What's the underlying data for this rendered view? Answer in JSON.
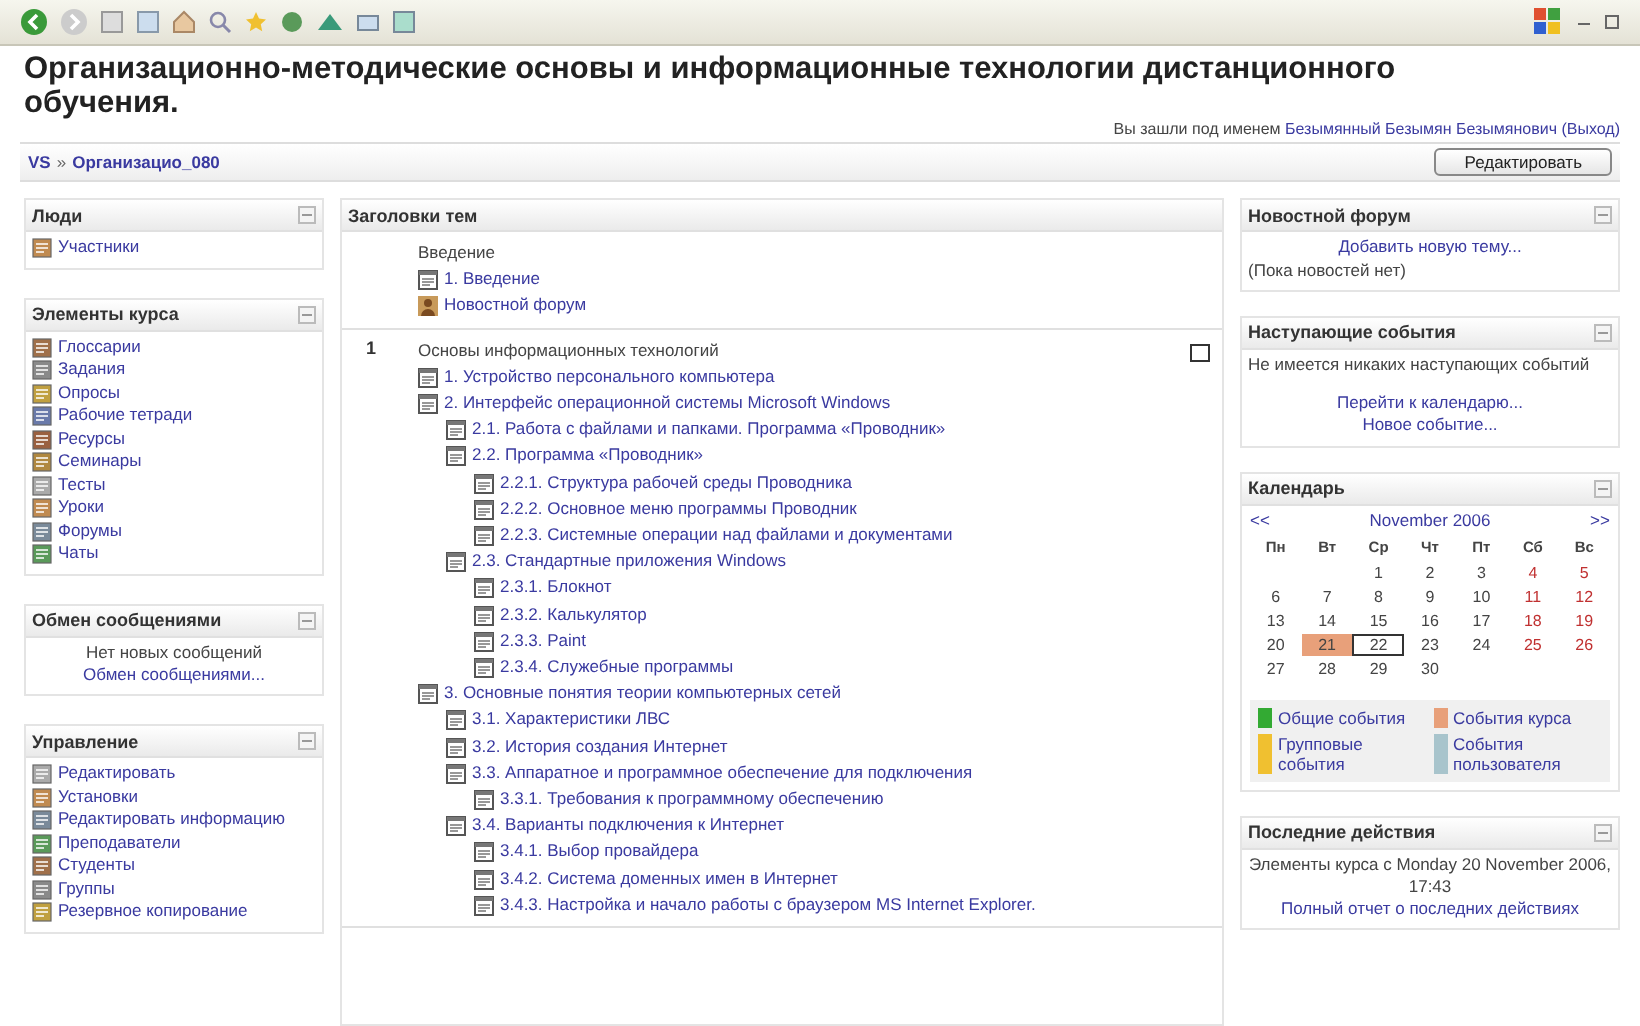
{
  "header": {
    "title": "Организационно-методические основы и информационные технологии дистанционного обучения.",
    "login": {
      "prefix": "Вы зашли под именем",
      "user": "Безымянный Безымян Безымянович",
      "logout": "(Выход)"
    }
  },
  "navbar": {
    "crumbs": [
      "VS",
      "Организацио_080"
    ],
    "separator": "»",
    "button": "Редактировать"
  },
  "left_blocks": [
    {
      "title": "Люди",
      "kind": "links",
      "items": [
        "Участники"
      ]
    },
    {
      "title": "Элементы курса",
      "kind": "links",
      "items": [
        "Глоссарии",
        "Задания",
        "Опросы",
        "Рабочие тетради",
        "Ресурсы",
        "Семинары",
        "Тесты",
        "Уроки",
        "Форумы",
        "Чаты"
      ]
    },
    {
      "title": "Обмен сообщениями",
      "kind": "text",
      "lines": [
        {
          "text": "Нет новых сообщений",
          "link": false
        },
        {
          "text": "Обмен сообщениями...",
          "link": true
        }
      ]
    },
    {
      "title": "Управление",
      "kind": "links",
      "items": [
        "Редактировать",
        "Установки",
        "Редактировать информацию",
        "Преподаватели",
        "Студенты",
        "Группы",
        "Резервное копирование"
      ]
    }
  ],
  "center": {
    "title": "Заголовки тем",
    "sections": [
      {
        "summary": "Введение",
        "items": [
          {
            "label": "1. Введение",
            "kind": "page"
          },
          {
            "label": "Новостной форум",
            "kind": "forum"
          }
        ]
      },
      {
        "number": "1",
        "summary": "Основы информационных технологий",
        "highlight_toggle": true,
        "items": [
          {
            "label": "1. Устройство персонального компьютера",
            "kind": "page"
          },
          {
            "label": "2. Интерфейс операционной системы Microsoft Windows",
            "kind": "page",
            "children": [
              {
                "label": "2.1. Работа с файлами и папками. Программа «Проводник»",
                "kind": "page"
              },
              {
                "label": "2.2. Программа «Проводник»",
                "kind": "page",
                "children": [
                  {
                    "label": "2.2.1. Структура рабочей среды Проводника",
                    "kind": "page"
                  },
                  {
                    "label": "2.2.2. Основное меню программы Проводник",
                    "kind": "page"
                  },
                  {
                    "label": "2.2.3. Системные операции над файлами и документами",
                    "kind": "page"
                  }
                ]
              },
              {
                "label": "2.3. Стандартные приложения Windows",
                "kind": "page",
                "children": [
                  {
                    "label": "2.3.1. Блокнот",
                    "kind": "page"
                  },
                  {
                    "label": "2.3.2. Калькулятор",
                    "kind": "page"
                  },
                  {
                    "label": "2.3.3. Paint",
                    "kind": "page"
                  },
                  {
                    "label": "2.3.4. Служебные программы",
                    "kind": "page"
                  }
                ]
              }
            ]
          },
          {
            "label": "3. Основные понятия теории компьютерных сетей",
            "kind": "page",
            "children": [
              {
                "label": "3.1. Характеристики ЛВС",
                "kind": "page"
              },
              {
                "label": "3.2. История создания Интернет",
                "kind": "page"
              },
              {
                "label": "3.3. Аппаратное и программное обеспечение для подключения",
                "kind": "page",
                "children": [
                  {
                    "label": "3.3.1. Требования к программному обеспечению",
                    "kind": "page"
                  }
                ]
              },
              {
                "label": "3.4. Варианты подключения к Интернет",
                "kind": "page",
                "children": [
                  {
                    "label": "3.4.1. Выбор провайдера",
                    "kind": "page"
                  },
                  {
                    "label": "3.4.2. Система доменных имен в Интернет",
                    "kind": "page"
                  },
                  {
                    "label": "3.4.3. Настройка и начало работы с браузером MS Internet Explorer.",
                    "kind": "page"
                  }
                ]
              }
            ]
          }
        ]
      }
    ]
  },
  "news": {
    "title": "Новостной форум",
    "link": "Добавить новую тему...",
    "note": "(Пока новостей нет)"
  },
  "upcoming": {
    "title": "Наступающие события",
    "note": "Не имеется никаких наступающих событий",
    "links": [
      "Перейти к календарю...",
      "Новое событие..."
    ]
  },
  "calendar": {
    "title": "Календарь",
    "prev": "<<",
    "month": "November 2006",
    "next": ">>",
    "weekdays": [
      "Пн",
      "Вт",
      "Ср",
      "Чт",
      "Пт",
      "Сб",
      "Вс"
    ],
    "weeks": [
      [
        {
          "d": "1",
          "event": false,
          "today": false
        },
        {
          "d": "2",
          "event": false,
          "today": false
        },
        {
          "d": "3",
          "event": false,
          "today": false
        },
        {
          "d": "4",
          "event": false,
          "today": false
        },
        {
          "d": "5",
          "event": false,
          "today": false
        }
      ],
      [
        {
          "d": "6",
          "event": false,
          "today": false
        },
        {
          "d": "7",
          "event": false,
          "today": false
        },
        {
          "d": "8",
          "event": false,
          "today": false
        },
        {
          "d": "9",
          "event": false,
          "today": false
        },
        {
          "d": "10",
          "event": false,
          "today": false
        },
        {
          "d": "11",
          "event": false,
          "today": false
        },
        {
          "d": "12",
          "event": false,
          "today": false
        }
      ],
      [
        {
          "d": "13",
          "event": false,
          "today": false
        },
        {
          "d": "14",
          "event": false,
          "today": false
        },
        {
          "d": "15",
          "event": false,
          "today": false
        },
        {
          "d": "16",
          "event": false,
          "today": false
        },
        {
          "d": "17",
          "event": false,
          "today": false
        },
        {
          "d": "18",
          "event": false,
          "today": false
        },
        {
          "d": "19",
          "event": false,
          "today": false
        }
      ],
      [
        {
          "d": "20",
          "event": false,
          "today": false
        },
        {
          "d": "21",
          "event": true,
          "today": false
        },
        {
          "d": "22",
          "event": false,
          "today": true
        },
        {
          "d": "23",
          "event": false,
          "today": false
        },
        {
          "d": "24",
          "event": false,
          "today": false
        },
        {
          "d": "25",
          "event": false,
          "today": false
        },
        {
          "d": "26",
          "event": false,
          "today": false
        }
      ],
      [
        {
          "d": "27",
          "event": false,
          "today": false
        },
        {
          "d": "28",
          "event": false,
          "today": false
        },
        {
          "d": "29",
          "event": false,
          "today": false
        },
        {
          "d": "30",
          "event": false,
          "today": false
        }
      ]
    ],
    "legend": [
      {
        "label": "Общие события",
        "color": "#33aa33"
      },
      {
        "label": "События курса",
        "color": "#e8a07a"
      },
      {
        "label": "Групповые события",
        "color": "#f0c030"
      },
      {
        "label": "События пользователя",
        "color": "#a8c4cc"
      }
    ]
  },
  "recent": {
    "title": "Последние действия",
    "note": "Элементы курса с Monday 20 November 2006, 17:43",
    "link": "Полный отчет о последних действиях"
  }
}
